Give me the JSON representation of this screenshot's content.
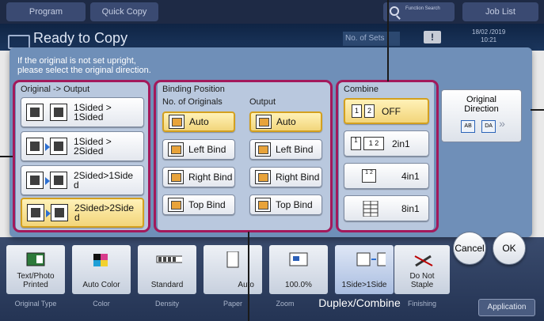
{
  "topbar": {
    "tabs": [
      "Program",
      "Quick Copy"
    ],
    "search_label": "Function Search",
    "job_list": "Job List"
  },
  "header": {
    "title": "Ready to Copy",
    "no_of_sets_label": "No. of Sets",
    "warning_symbol": "!",
    "date": "18/02 /2019",
    "time": "10:21"
  },
  "dialog": {
    "message_line1": "If the original is not set upright,",
    "message_line2": "please select the original direction.",
    "original_output": {
      "header": "Original -> Output",
      "options": [
        {
          "label": "1Sided >\n1Sided",
          "selected": false
        },
        {
          "label": "1Sided >\n2Sided",
          "selected": false
        },
        {
          "label": "2Sided>1Side\nd",
          "selected": false
        },
        {
          "label": "2Sided>2Side\nd",
          "selected": true
        }
      ]
    },
    "binding": {
      "header": "Binding Position",
      "originals_label": "No. of Originals",
      "output_label": "Output",
      "originals": [
        {
          "label": "Auto",
          "selected": true
        },
        {
          "label": "Left Bind",
          "selected": false
        },
        {
          "label": "Right Bind",
          "selected": false
        },
        {
          "label": "Top Bind",
          "selected": false
        }
      ],
      "output": [
        {
          "label": "Auto",
          "selected": true
        },
        {
          "label": "Left Bind",
          "selected": false
        },
        {
          "label": "Right Bind",
          "selected": false
        },
        {
          "label": "Top Bind",
          "selected": false
        }
      ]
    },
    "combine": {
      "header": "Combine",
      "options": [
        {
          "label": "OFF",
          "selected": true,
          "icon_text": [
            "1",
            "2"
          ]
        },
        {
          "label": "2in1",
          "selected": false,
          "icon_text": [
            "1",
            "2",
            "1 2"
          ]
        },
        {
          "label": "4in1",
          "selected": false,
          "icon_text": [
            "1 2",
            "3 4"
          ]
        },
        {
          "label": "8in1",
          "selected": false,
          "icon_text": []
        }
      ]
    },
    "original_direction": {
      "label_line1": "Original",
      "label_line2": "Direction",
      "icon_text": [
        "AB",
        "DA"
      ],
      "more": "»"
    },
    "cancel": "Cancel",
    "ok": "OK"
  },
  "bottom": {
    "tiles": [
      {
        "value": "Text/Photo\nPrinted",
        "caption": "Original Type"
      },
      {
        "value": "Auto Color",
        "caption": "Color"
      },
      {
        "value": "Standard",
        "caption": "Density"
      },
      {
        "value": "Auto",
        "caption": "Paper"
      },
      {
        "value": "100.0%",
        "caption": "Zoom"
      },
      {
        "value": "1Side>1Side",
        "caption": "Duplex/Combine"
      },
      {
        "value": "Do Not\nStaple",
        "caption": "Finishing"
      }
    ],
    "application": "Application"
  },
  "colors": {
    "callout": "#a3195b",
    "dialog": "#6f8fb8",
    "selected": "#f2d57a"
  }
}
